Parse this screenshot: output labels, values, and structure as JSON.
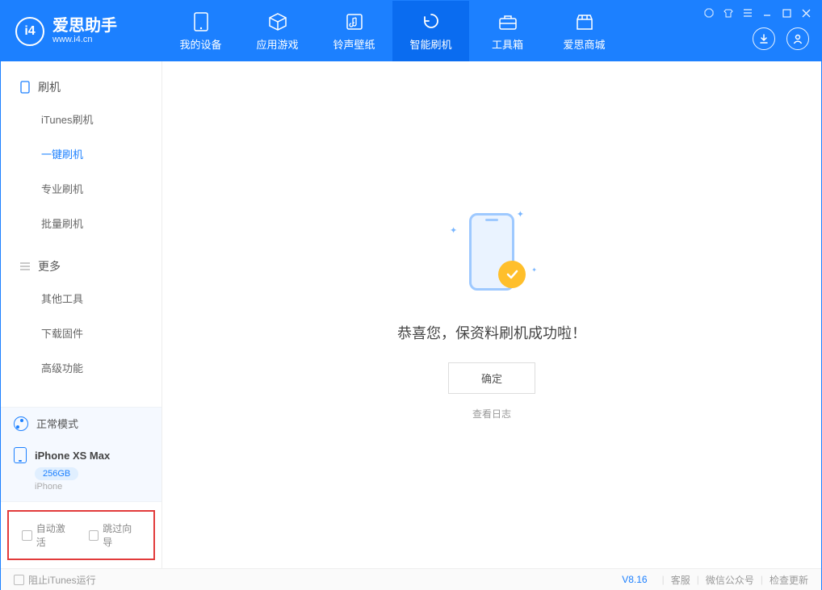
{
  "app": {
    "title": "爱思助手",
    "subtitle": "www.i4.cn"
  },
  "tabs": {
    "device": "我的设备",
    "apps": "应用游戏",
    "ring": "铃声壁纸",
    "flash": "智能刷机",
    "tools": "工具箱",
    "store": "爱思商城"
  },
  "sidebar": {
    "group1": {
      "title": "刷机",
      "items": [
        "iTunes刷机",
        "一键刷机",
        "专业刷机",
        "批量刷机"
      ]
    },
    "group2": {
      "title": "更多",
      "items": [
        "其他工具",
        "下载固件",
        "高级功能"
      ]
    }
  },
  "mode": {
    "label": "正常模式"
  },
  "device": {
    "name": "iPhone XS Max",
    "capacity": "256GB",
    "type": "iPhone"
  },
  "options": {
    "auto_activate": "自动激活",
    "skip_guide": "跳过向导"
  },
  "main": {
    "success_text": "恭喜您，保资料刷机成功啦！",
    "ok_button": "确定",
    "view_log": "查看日志"
  },
  "footer": {
    "block_itunes": "阻止iTunes运行",
    "version": "V8.16",
    "support": "客服",
    "wechat": "微信公众号",
    "update": "检查更新"
  }
}
